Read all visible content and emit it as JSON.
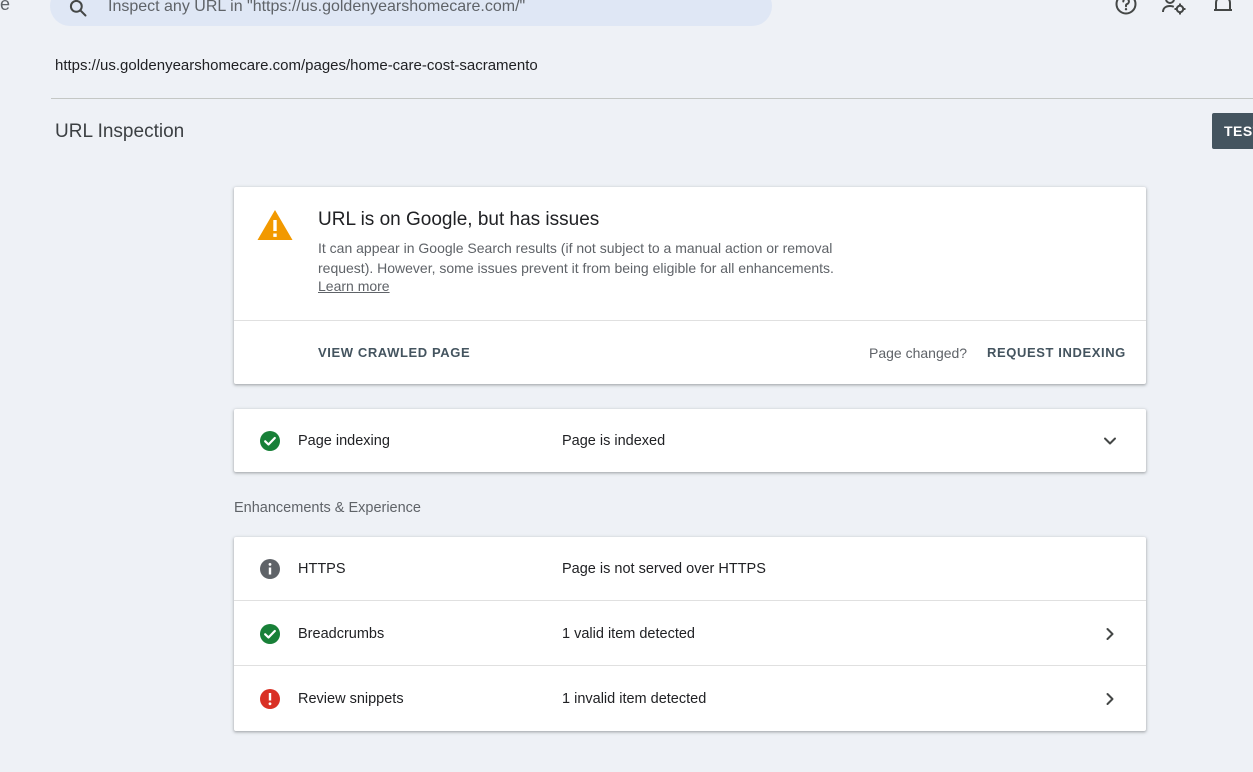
{
  "header": {
    "left_stub": "e",
    "search_placeholder": "Inspect any URL in \"https://us.goldenyearshomecare.com/\"",
    "icons": [
      "help-icon",
      "search-console-settings-icon",
      "notifications-icon"
    ]
  },
  "inspected_url": "https://us.goldenyearshomecare.com/pages/home-care-cost-sacramento",
  "page_title": "URL Inspection",
  "test_button_label": "TEST",
  "status": {
    "icon": "warning-icon",
    "headline": "URL is on Google, but has issues",
    "description": "It can appear in Google Search results (if not subject to a manual action or removal request). However, some issues prevent it from being eligible for all enhancements.",
    "learn_more": "Learn more",
    "view_crawled": "VIEW CRAWLED PAGE",
    "page_changed": "Page changed?",
    "request_indexing": "REQUEST INDEXING"
  },
  "indexing": {
    "icon": "check-circle-icon",
    "label": "Page indexing",
    "value": "Page is indexed"
  },
  "enhancements": {
    "section_label": "Enhancements & Experience",
    "rows": [
      {
        "icon": "info-icon",
        "label": "HTTPS",
        "value": "Page is not served over HTTPS"
      },
      {
        "icon": "check-circle-icon",
        "label": "Breadcrumbs",
        "value": "1 valid item detected"
      },
      {
        "icon": "error-icon",
        "label": "Review snippets",
        "value": "1 invalid item detected"
      }
    ]
  },
  "colors": {
    "warning": "#f29900",
    "success": "#188038",
    "error": "#d93025",
    "info": "#5f6368",
    "button_dark": "#44545f",
    "background": "#eef1f6"
  }
}
